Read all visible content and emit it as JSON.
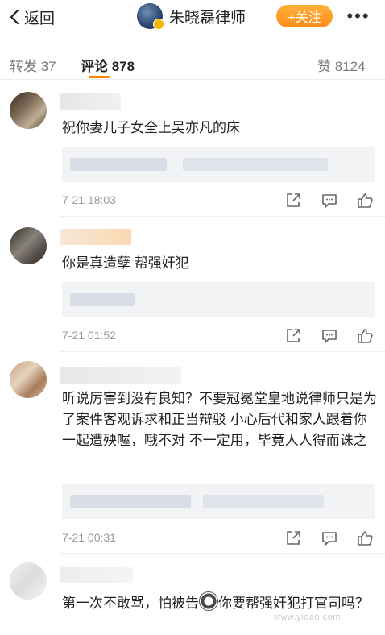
{
  "header": {
    "back_label": "返回",
    "name": "朱晓磊律师",
    "follow_label": "+关注",
    "more_label": "•••"
  },
  "tabs": [
    {
      "label": "转发 37"
    },
    {
      "label": "评论 878"
    },
    {
      "label": "赞 8124"
    }
  ],
  "comments": [
    {
      "text": "祝你妻儿子女全上吴亦凡的床",
      "time": "7-21 18:03"
    },
    {
      "text": "你是真造孽  帮强奸犯",
      "time": "7-21 01:52"
    },
    {
      "text": "听说厉害到没有良知？不要冠冕堂皇地说律师只是为了案件客观诉求和正当辩驳 小心后代和家人跟着你一起遭殃喔，哦不对 不一定用，毕竟人人得而诛之",
      "time": "7-21 00:31"
    },
    {
      "text_before": "第一次不敢骂，怕被告",
      "text_after": "你要帮强奸犯打官司吗？"
    }
  ],
  "watermark": "www.yidao.com",
  "colors": {
    "accent": "#ff8200",
    "follow_btn": "#ff9a2a",
    "quote_bg": "#f2f3f5"
  }
}
